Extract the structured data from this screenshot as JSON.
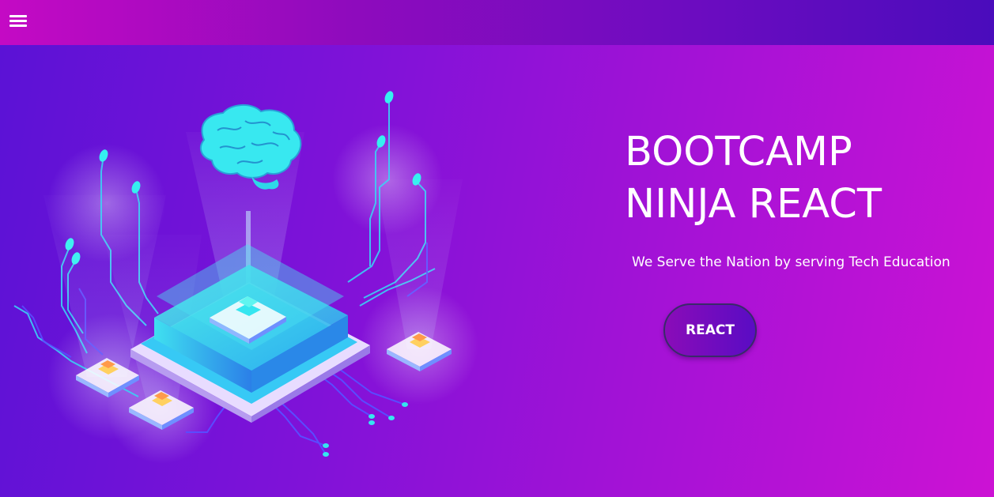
{
  "header": {
    "menu_icon": "hamburger-menu-icon"
  },
  "hero": {
    "title_line1": "BOOTCAMP",
    "title_line2": "NINJA REACT",
    "subtitle": "We Serve the Nation by serving Tech Education",
    "cta_label": "REACT"
  },
  "illustration": {
    "icon": "isometric-ai-chip-brain-illustration"
  },
  "colors": {
    "topbar_start": "#c40ac4",
    "topbar_end": "#4a0cbc",
    "bg_start": "#5a12d6",
    "bg_end": "#cc12d4",
    "accent_cyan": "#35e6f0",
    "button_start": "#8a0cb8",
    "button_end": "#5a0cc4"
  }
}
